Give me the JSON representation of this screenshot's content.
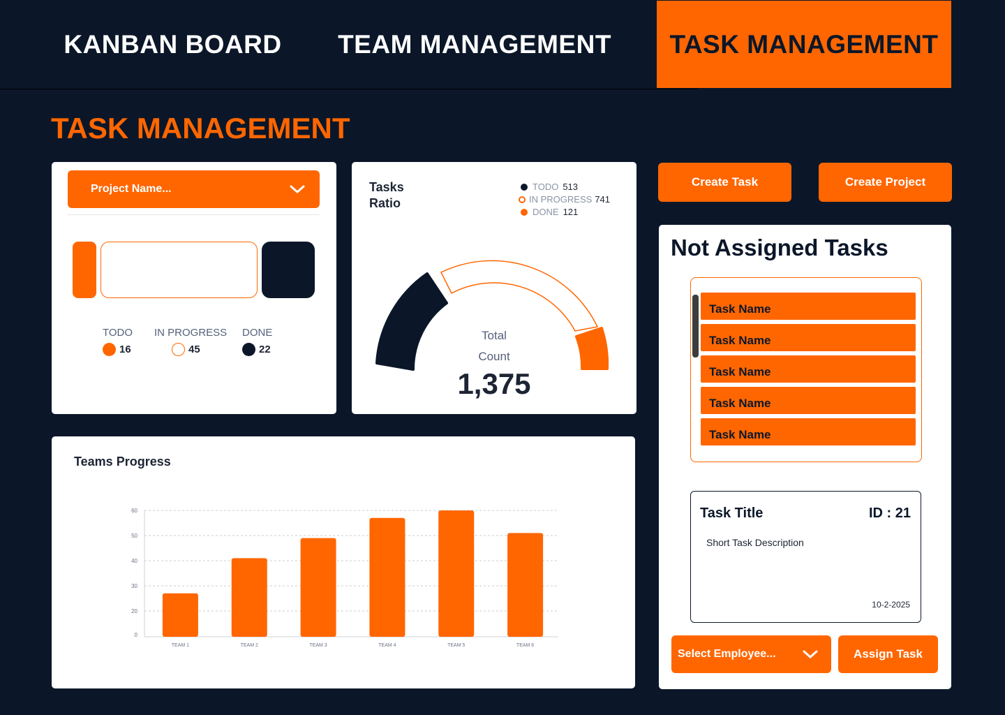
{
  "nav": {
    "tabs": [
      {
        "label": "KANBAN BOARD"
      },
      {
        "label": "TEAM MANAGEMENT"
      },
      {
        "label": "TASK MANAGEMENT",
        "active": true
      }
    ]
  },
  "page": {
    "title": "TASK MANAGEMENT"
  },
  "project_card": {
    "select_label": "Project Name...",
    "legend": [
      {
        "label": "TODO",
        "value": "16"
      },
      {
        "label": "IN PROGRESS",
        "value": "45"
      },
      {
        "label": "DONE",
        "value": "22"
      }
    ]
  },
  "ratio_card": {
    "title_line1": "Tasks",
    "title_line2": "Ratio",
    "legend": [
      {
        "label": "TODO",
        "value": "513"
      },
      {
        "label": "IN PROGRESS",
        "value": "741"
      },
      {
        "label": "DONE",
        "value": "121"
      }
    ],
    "total_line1": "Total",
    "total_line2": "Count",
    "total_value": "1,375"
  },
  "teams": {
    "title": "Teams Progress"
  },
  "actions": {
    "create_task": "Create Task",
    "create_project": "Create Project"
  },
  "not_assigned": {
    "title": "Not Assigned Tasks",
    "tasks": [
      "Task Name",
      "Task Name",
      "Task Name",
      "Task Name",
      "Task Name"
    ],
    "detail": {
      "title": "Task Title",
      "id": "ID : 21",
      "description": "Short Task Description",
      "date": "10-2-2025"
    },
    "employee_select": "Select Employee...",
    "assign_button": "Assign Task"
  },
  "colors": {
    "accent": "#ff6600",
    "navy": "#0b1729",
    "white": "#ffffff"
  },
  "chart_data": {
    "type": "bar",
    "categories": [
      "TEAM 1",
      "TEAM 2",
      "TEAM 3",
      "TEAM 4",
      "TEAM 5",
      "TEAM 6"
    ],
    "values": [
      27,
      41,
      49,
      57,
      60,
      51
    ],
    "yticks": [
      0,
      20,
      30,
      40,
      50,
      60
    ],
    "ylim": [
      0,
      60
    ],
    "grid": true
  }
}
